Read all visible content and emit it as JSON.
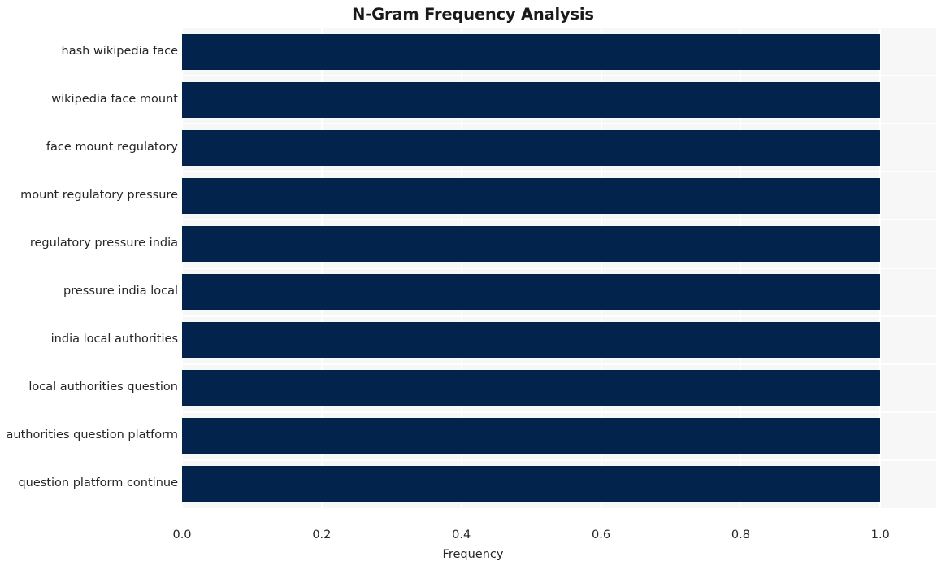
{
  "chart_data": {
    "type": "bar",
    "orientation": "horizontal",
    "title": "N-Gram Frequency Analysis",
    "xlabel": "Frequency",
    "ylabel": "",
    "categories": [
      "hash wikipedia face",
      "wikipedia face mount",
      "face mount regulatory",
      "mount regulatory pressure",
      "regulatory pressure india",
      "pressure india local",
      "india local authorities",
      "local authorities question",
      "authorities question platform",
      "question platform continue"
    ],
    "values": [
      1.0,
      1.0,
      1.0,
      1.0,
      1.0,
      1.0,
      1.0,
      1.0,
      1.0,
      1.0
    ],
    "xlim": [
      0.0,
      1.08
    ],
    "xticks": [
      0.0,
      0.2,
      0.4,
      0.6,
      0.8,
      1.0
    ],
    "xtick_labels": [
      "0.0",
      "0.2",
      "0.4",
      "0.6",
      "0.8",
      "1.0"
    ],
    "grid": true,
    "legend": null,
    "bar_color": "#02234c",
    "plot_background": "#f7f7f7",
    "gridline_color": "#ffffff",
    "figure_background": "#ffffff",
    "title_color": "#1a1a1a",
    "tick_label_color": "#262626"
  }
}
